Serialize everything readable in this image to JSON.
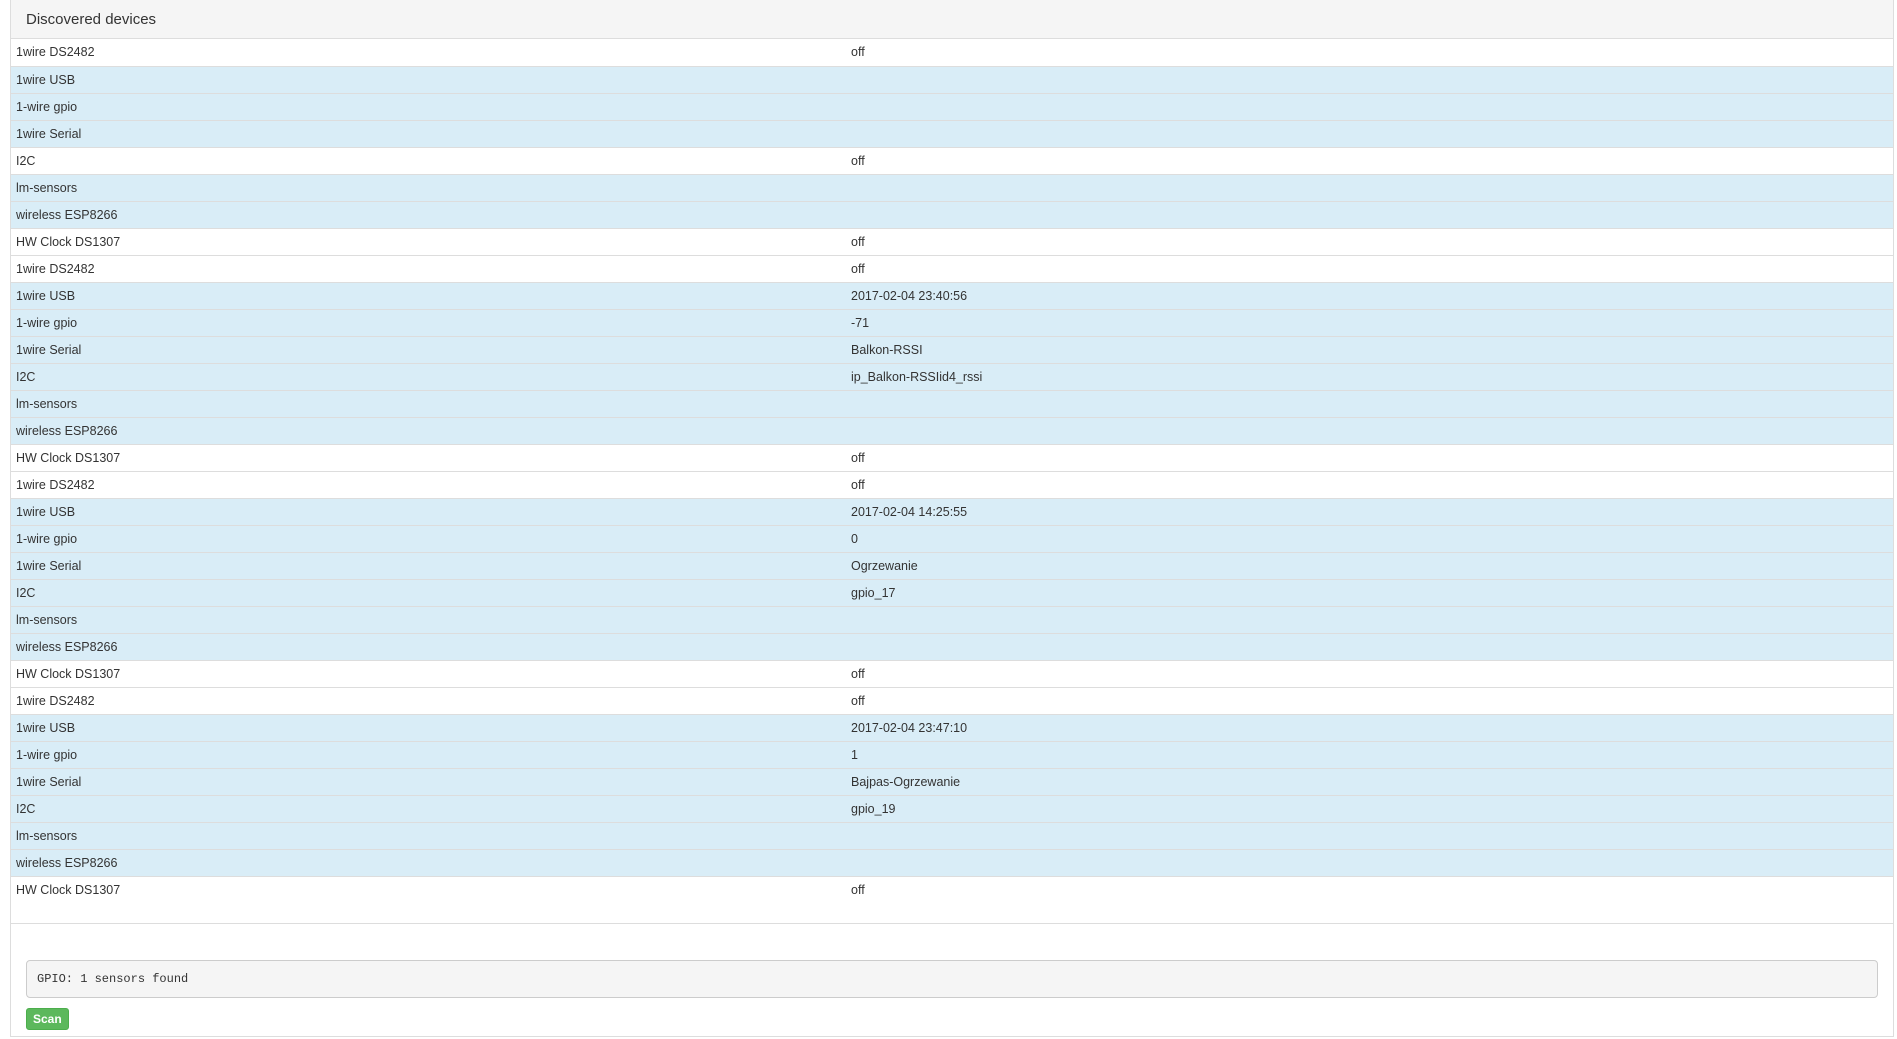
{
  "panel": {
    "title": "Discovered devices"
  },
  "devices": [
    {
      "name": "1wire DS2482",
      "value": "off",
      "info": false
    },
    {
      "name": "1wire USB",
      "value": "",
      "info": true
    },
    {
      "name": "1-wire gpio",
      "value": "",
      "info": true
    },
    {
      "name": "1wire Serial",
      "value": "",
      "info": true
    },
    {
      "name": "I2C",
      "value": "off",
      "info": false
    },
    {
      "name": "lm-sensors",
      "value": "",
      "info": true
    },
    {
      "name": "wireless ESP8266",
      "value": "",
      "info": true
    },
    {
      "name": "HW Clock DS1307",
      "value": "off",
      "info": false
    },
    {
      "name": "1wire DS2482",
      "value": "off",
      "info": false
    },
    {
      "name": "1wire USB",
      "value": "2017-02-04 23:40:56",
      "info": true
    },
    {
      "name": "1-wire gpio",
      "value": "-71",
      "info": true
    },
    {
      "name": "1wire Serial",
      "value": "Balkon-RSSI",
      "info": true
    },
    {
      "name": "I2C",
      "value": "ip_Balkon-RSSIid4_rssi",
      "info": true
    },
    {
      "name": "lm-sensors",
      "value": "",
      "info": true
    },
    {
      "name": "wireless ESP8266",
      "value": "",
      "info": true
    },
    {
      "name": "HW Clock DS1307",
      "value": "off",
      "info": false
    },
    {
      "name": "1wire DS2482",
      "value": "off",
      "info": false
    },
    {
      "name": "1wire USB",
      "value": "2017-02-04 14:25:55",
      "info": true
    },
    {
      "name": "1-wire gpio",
      "value": "0",
      "info": true
    },
    {
      "name": "1wire Serial",
      "value": "Ogrzewanie",
      "info": true
    },
    {
      "name": "I2C",
      "value": "gpio_17",
      "info": true
    },
    {
      "name": "lm-sensors",
      "value": "",
      "info": true
    },
    {
      "name": "wireless ESP8266",
      "value": "",
      "info": true
    },
    {
      "name": "HW Clock DS1307",
      "value": "off",
      "info": false
    },
    {
      "name": "1wire DS2482",
      "value": "off",
      "info": false
    },
    {
      "name": "1wire USB",
      "value": "2017-02-04 23:47:10",
      "info": true
    },
    {
      "name": "1-wire gpio",
      "value": "1",
      "info": true
    },
    {
      "name": "1wire Serial",
      "value": "Bajpas-Ogrzewanie",
      "info": true
    },
    {
      "name": "I2C",
      "value": "gpio_19",
      "info": true
    },
    {
      "name": "lm-sensors",
      "value": "",
      "info": true
    },
    {
      "name": "wireless ESP8266",
      "value": "",
      "info": true
    },
    {
      "name": "HW Clock DS1307",
      "value": "off",
      "info": false
    }
  ],
  "log": {
    "text": "GPIO: 1 sensors found"
  },
  "actions": {
    "scan_label": "Scan"
  },
  "colors": {
    "info_row": "#d9edf7",
    "scan_button": "#5cb85c"
  }
}
